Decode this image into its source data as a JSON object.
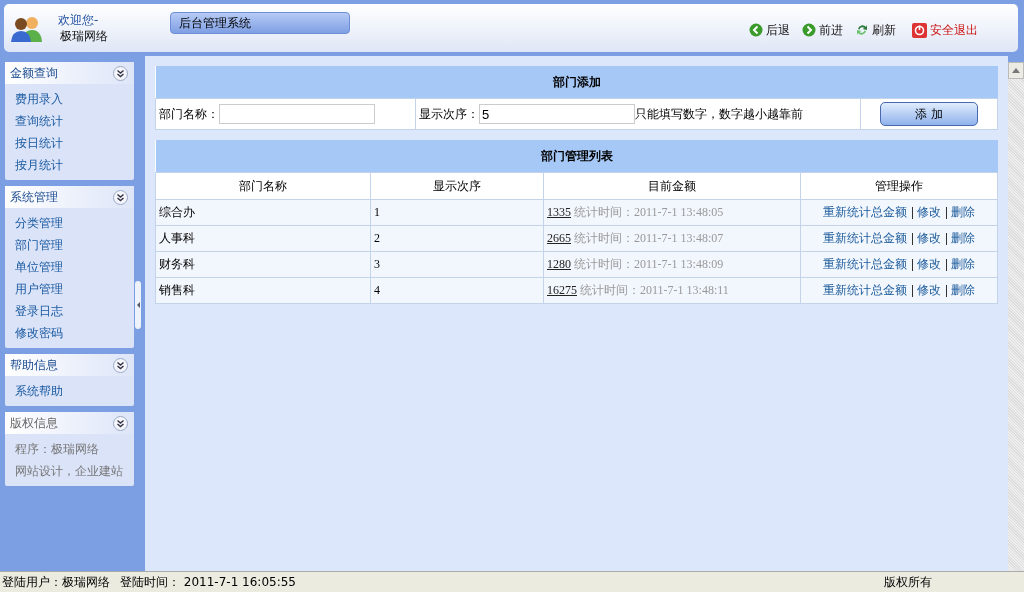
{
  "header": {
    "welcome": "欢迎您-",
    "user": "极瑞网络",
    "system_title": "后台管理系统",
    "nav": [
      {
        "kind": "back",
        "label": "后退"
      },
      {
        "kind": "forward",
        "label": "前进"
      },
      {
        "kind": "refresh",
        "label": "刷新"
      },
      {
        "kind": "logout",
        "label": "安全退出"
      }
    ]
  },
  "sidebar": {
    "groups": [
      {
        "title": "金额查询",
        "kind": "menu",
        "items": [
          "费用录入",
          "查询统计",
          "按日统计",
          "按月统计"
        ]
      },
      {
        "title": "系统管理",
        "kind": "menu",
        "items": [
          "分类管理",
          "部门管理",
          "单位管理",
          "用户管理",
          "登录日志",
          "修改密码"
        ]
      },
      {
        "title": "帮助信息",
        "kind": "menu",
        "items": [
          "系统帮助"
        ]
      },
      {
        "title": "版权信息",
        "kind": "info",
        "items": [
          "程序：极瑞网络",
          "网站设计，企业建站"
        ]
      }
    ]
  },
  "add_form": {
    "title": "部门添加",
    "name_label": "部门名称：",
    "order_label": "显示次序：",
    "order_value": "5",
    "hint": "只能填写数字，数字越小越靠前",
    "button": "添 加"
  },
  "table": {
    "title": "部门管理列表",
    "columns": [
      "部门名称",
      "显示次序",
      "目前金额",
      "管理操作"
    ],
    "rows": [
      {
        "name": "综合办",
        "order": "1",
        "amount": "1335",
        "time": "统计时间：2011-7-1 13:48:05",
        "actions": [
          "重新统计总金额",
          "修改",
          "删除"
        ]
      },
      {
        "name": "人事科",
        "order": "2",
        "amount": "2665",
        "time": "统计时间：2011-7-1 13:48:07",
        "actions": [
          "重新统计总金额",
          "修改",
          "删除"
        ]
      },
      {
        "name": "财务科",
        "order": "3",
        "amount": "1280",
        "time": "统计时间：2011-7-1 13:48:09",
        "actions": [
          "重新统计总金额",
          "修改",
          "删除"
        ]
      },
      {
        "name": "销售科",
        "order": "4",
        "amount": "16275",
        "time": "统计时间：2011-7-1 13:48:11",
        "actions": [
          "重新统计总金额",
          "修改",
          "删除"
        ]
      }
    ]
  },
  "status_bar": {
    "user": "登陆用户：极瑞网络",
    "time": "登陆时间： 2011-7-1 16:05:55",
    "copyright": "版权所有"
  }
}
